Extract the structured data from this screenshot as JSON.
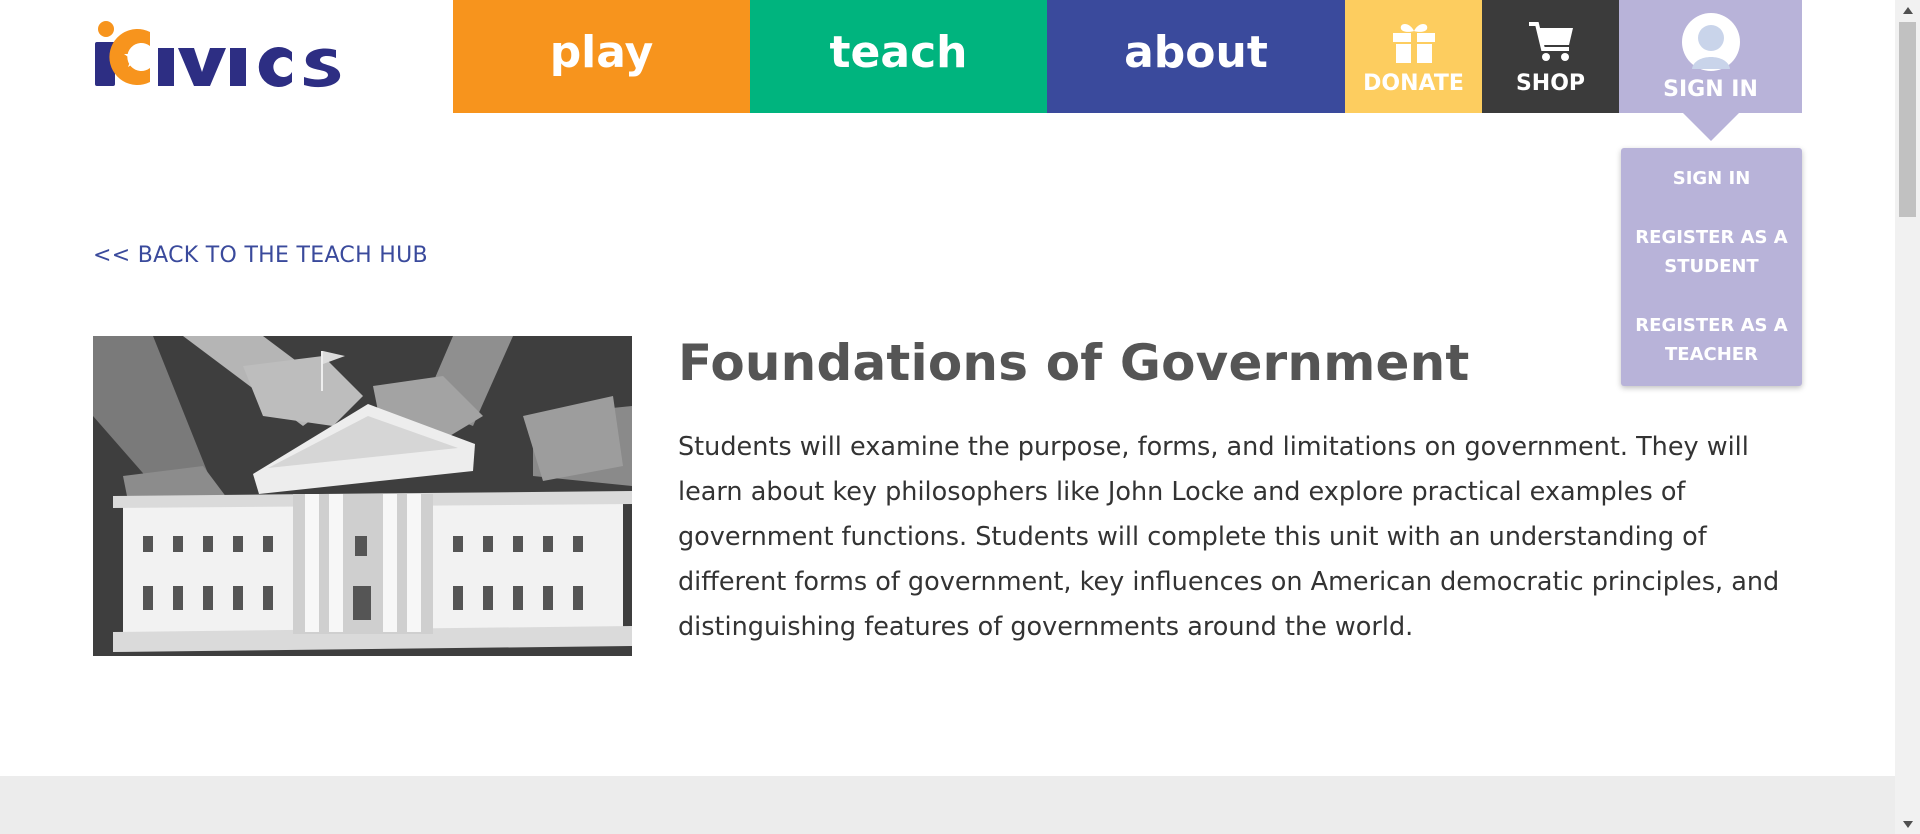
{
  "brand": {
    "logo_text": "iCivics"
  },
  "nav": {
    "play": "play",
    "teach": "teach",
    "about": "about",
    "donate": "DONATE",
    "shop": "SHOP",
    "signin": "SIGN IN"
  },
  "dropdown": {
    "items": [
      "SIGN IN",
      "REGISTER AS A STUDENT",
      "REGISTER AS A TEACHER"
    ]
  },
  "page": {
    "back_link": "<< BACK TO THE TEACH HUB",
    "title": "Foundations of Government",
    "description": "Students will examine the purpose, forms, and limitations on government. They will learn about key philosophers like John Locke and explore practical examples of government functions. Students will complete this unit with an understanding of different forms of government, key influences on American democratic principles, and distinguishing features of governments around the world."
  },
  "colors": {
    "play": "#f7941d",
    "teach": "#00b47e",
    "about": "#3a4a9c",
    "donate": "#fdcd5f",
    "shop": "#3b3b3b",
    "signin": "#b8b3d9"
  },
  "icons": {
    "donate": "gift-icon",
    "shop": "cart-icon",
    "signin": "user-avatar-icon"
  }
}
